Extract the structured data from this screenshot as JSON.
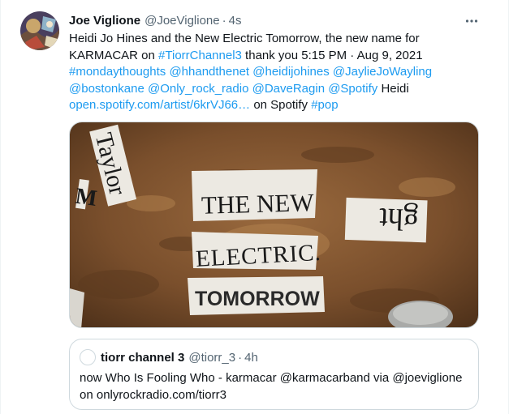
{
  "tweet": {
    "author": {
      "name": "Joe Viglione",
      "handle": "@JoeViglione",
      "separator": "·",
      "time": "4s"
    },
    "more_icon": "more-horizontal-icon",
    "text": {
      "line1": "Heidi Jo Hines and the New Electric Tomorrow, the new name for",
      "line2_a": "KARMACAR on ",
      "line2_tag": "#TiorrChannel3",
      "line2_b": " thank you 5:15 PM · Aug 9, 2021",
      "line3": [
        "#mondaythoughts",
        "@hhandthenet",
        "@heidijohines",
        "@JaylieJoWayling"
      ],
      "line4": [
        "@bostonkane",
        "@Only_rock_radio",
        "@DaveRagin",
        "@Spotify"
      ],
      "line4_tail": " Heidi",
      "line5_link": "open.spotify.com/artist/6krVJ66…",
      "line5_mid": " on Spotify ",
      "line5_tag": "#pop"
    },
    "media": {
      "clip1": "THE NEW",
      "clip2": "ELECTRIC.",
      "clip3": "TOMORROW",
      "clip_left": "Taylor",
      "clip_right": "ght",
      "clip_edge": "M"
    },
    "quote": {
      "name": "tiorr channel 3",
      "handle": "@tiorr_3",
      "separator": "·",
      "time": "4h",
      "line1": "now Who Is Fooling Who - karmacar @karmacarband via @joeviglione",
      "line2": "on onlyrockradio.com/tiorr3"
    }
  },
  "colors": {
    "link": "#1d9bf0",
    "text": "#0f1419",
    "muted": "#536471",
    "border": "#cfd9de"
  }
}
